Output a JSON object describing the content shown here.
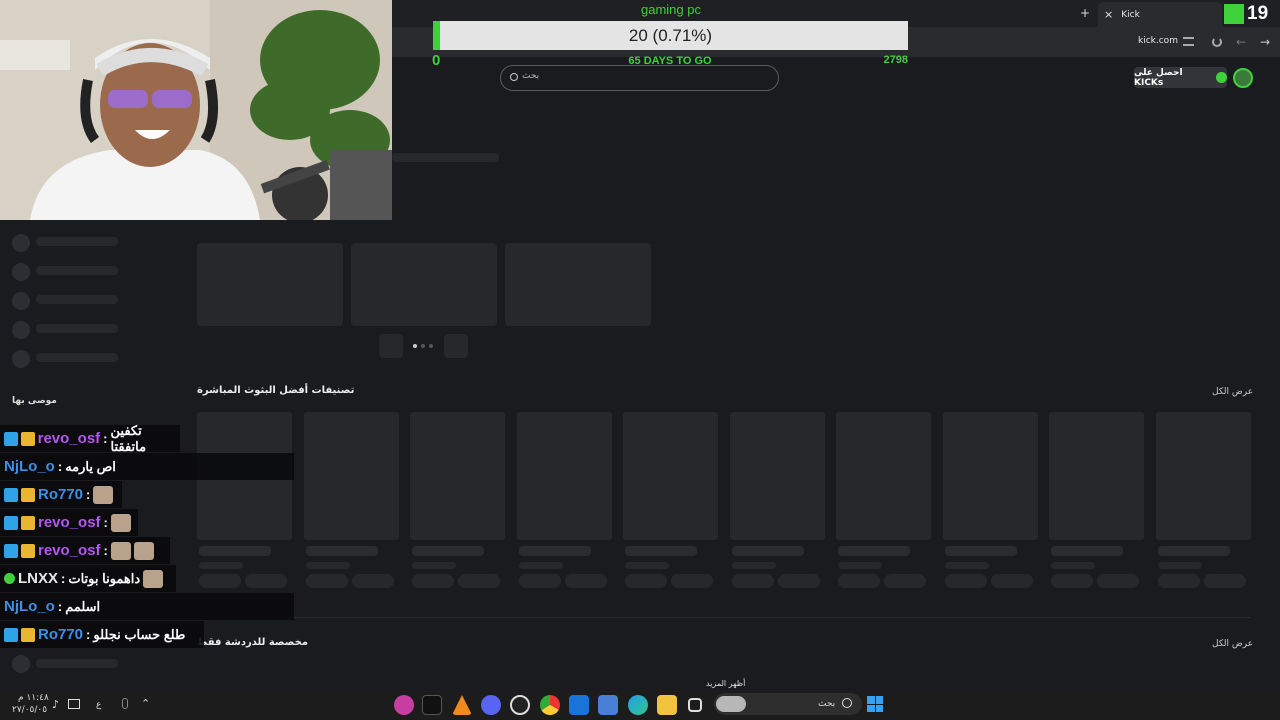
{
  "browser": {
    "tab_title": "Kick",
    "url": "kick.com",
    "new_tab_symbol": "+",
    "close_symbol": "×",
    "kick_logo_text": "19"
  },
  "goal": {
    "title": "gaming pc",
    "progress_text": "20 (0.71%)",
    "progress_fraction": 0.0071,
    "min_label": "0",
    "days_label": "65 DAYS TO GO",
    "max_label": "2798"
  },
  "search": {
    "placeholder": "بحث"
  },
  "header": {
    "kicks_button": "احصل على KICKs"
  },
  "sections": {
    "top_categories": "تصنيفات أفضل البثوث المباشرة",
    "view_all_1": "عرض الكل",
    "view_all_2": "عرض الكل",
    "recommended": "موصى بها",
    "chat_only": "مخصصة للدردشة فقط",
    "show_more": "أظهر المزيد"
  },
  "chat": [
    {
      "badges": [
        "blue",
        "gold"
      ],
      "user": "revo_osf",
      "color": "purple",
      "message": "تكفين ماتفقتا",
      "emotes": 0
    },
    {
      "badges": [],
      "user": "NjLo_o",
      "color": "blue",
      "message": "اص يارمه",
      "emotes": 0
    },
    {
      "badges": [
        "blue",
        "gold"
      ],
      "user": "Ro770",
      "color": "blue",
      "message": "",
      "emotes": 1
    },
    {
      "badges": [
        "blue",
        "gold"
      ],
      "user": "revo_osf",
      "color": "purple",
      "message": "",
      "emotes": 1
    },
    {
      "badges": [
        "blue",
        "gold"
      ],
      "user": "revo_osf",
      "color": "purple",
      "message": "",
      "emotes": 2
    },
    {
      "badges": [
        "green"
      ],
      "user": "LNXX",
      "color": "white",
      "message": "داهمونا بوتات",
      "emotes": 1
    },
    {
      "badges": [],
      "user": "NjLo_o",
      "color": "blue",
      "message": "اسلمم",
      "emotes": 0
    },
    {
      "badges": [
        "blue",
        "gold"
      ],
      "user": "Ro770",
      "color": "blue",
      "message": "طلع حساب نجللو",
      "emotes": 0
    }
  ],
  "taskbar": {
    "time": "١١:٤٨ م",
    "date": "٢٧/٠٥/٠٥",
    "lang": "ع",
    "search_placeholder": "بحث"
  },
  "colors": {
    "accent": "#3fd13c",
    "bg": "#191b1f",
    "skeleton": "#26282c"
  }
}
